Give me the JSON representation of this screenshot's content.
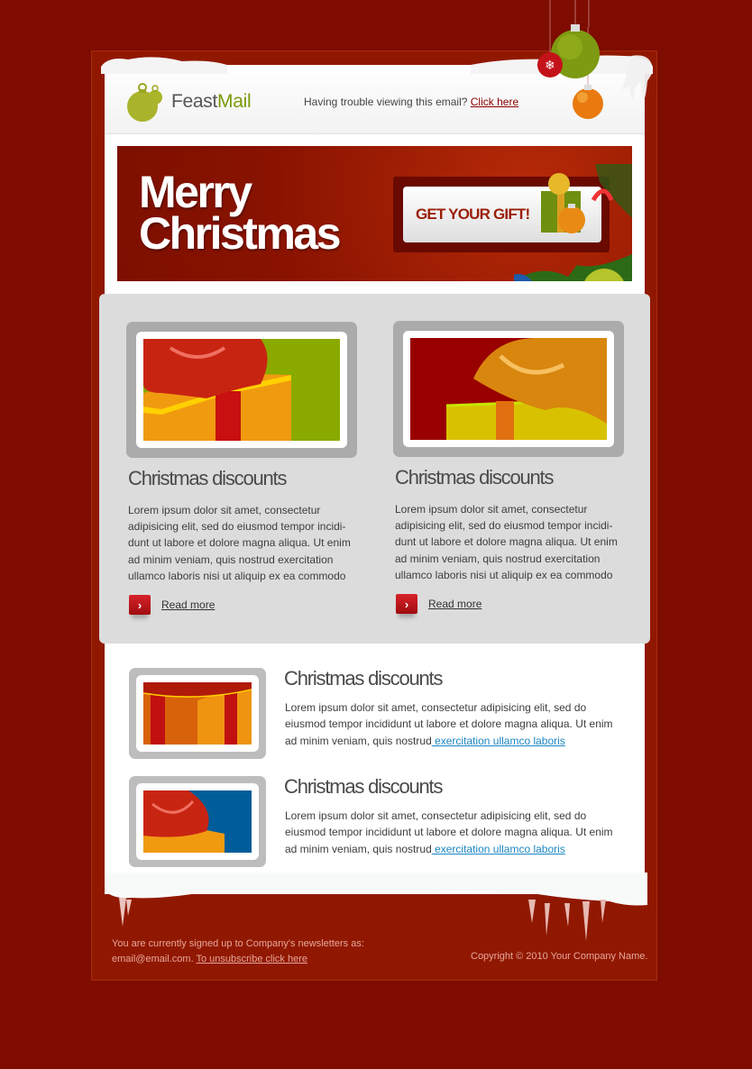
{
  "header": {
    "logo_main": "Feast",
    "logo_accent": "Mail",
    "trouble_text": "Having trouble viewing this email? ",
    "trouble_link": "Click here"
  },
  "banner": {
    "title_line1": "Merry",
    "title_line2": "Christmas",
    "cta_label": "GET YOUR GIFT!"
  },
  "featured": [
    {
      "title": "Christmas discounts",
      "body": "Lorem ipsum dolor sit amet, consectetur adipisicing elit, sed do eiusmod tempor incidi-dunt ut labore et dolore magna aliqua. Ut enim ad minim veniam, quis nostrud exercitation ullamco laboris nisi ut aliquip ex ea commodo",
      "read_more": "Read more",
      "image_bg": "#8aaa00",
      "image_desc": "red bow gift box on green"
    },
    {
      "title": "Christmas discounts",
      "body": "Lorem ipsum dolor sit amet, consectetur adipisicing elit, sed do eiusmod tempor incidi-dunt ut labore et dolore magna aliqua. Ut enim ad minim veniam, quis nostrud exercitation ullamco laboris nisi ut aliquip ex ea commodo",
      "read_more": "Read more",
      "image_bg": "#990000",
      "image_desc": "gold bow gift box on red"
    }
  ],
  "list": [
    {
      "title": "Christmas discounts",
      "body": "Lorem ipsum dolor sit amet, consectetur adipisicing elit, sed do eiusmod tempor incididunt ut labore et dolore magna aliqua. Ut enim ad minim veniam, quis nostrud",
      "link": " exercitation ullamco laboris",
      "image_bg": "#c45a00"
    },
    {
      "title": "Christmas discounts",
      "body": "Lorem ipsum dolor sit amet, consectetur adipisicing elit, sed do eiusmod tempor incididunt ut labore et dolore magna aliqua. Ut enim ad minim veniam, quis nostrud",
      "link": " exercitation ullamco laboris",
      "image_bg": "#005d99"
    }
  ],
  "footer": {
    "line1": "You are currently signed up to Company's newsletters as:",
    "email": "email@email.com. ",
    "unsubscribe": "To unsubscribe click here",
    "copyright": "Copyright © 2010 Your Company Name."
  },
  "colors": {
    "page_bg": "#7e0c00",
    "frame_bg": "#911800",
    "accent_green": "#7a9a0a",
    "link_blue": "#1b86c2",
    "cta_text": "#9a1e08"
  }
}
